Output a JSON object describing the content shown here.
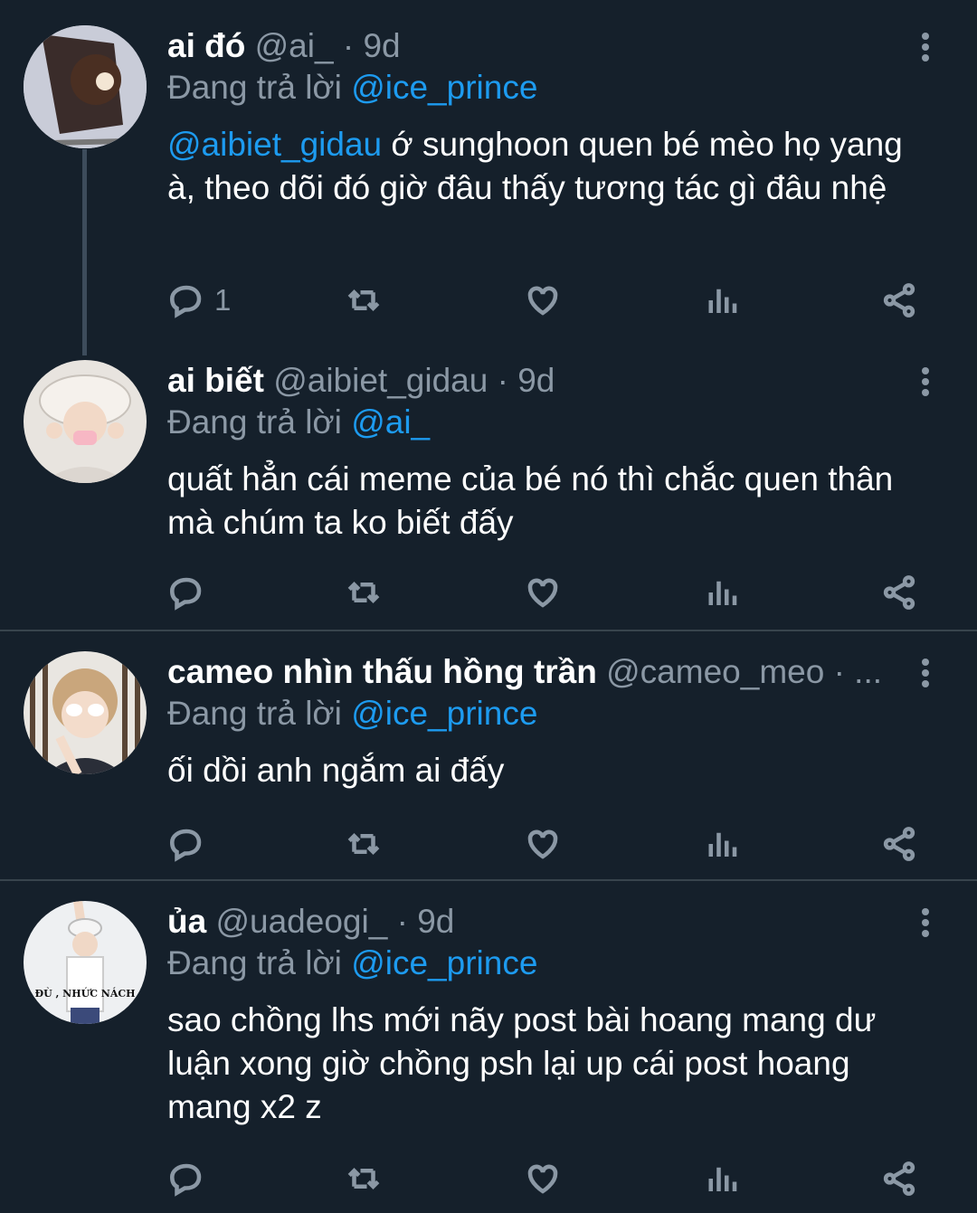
{
  "replying_label": "Đang trả lời",
  "tweets": [
    {
      "name": "ai đó",
      "handle": "@ai_",
      "dot": " · ",
      "time": "9d",
      "reply_to": "@ice_prince",
      "body_mention": "@aibiet_gidau",
      "body_text": " ớ sunghoon quen bé mèo họ yang à, theo dõi đó giờ đâu thấy tương tác gì đâu nhệ",
      "reply_count": "1"
    },
    {
      "name": "ai biết",
      "handle": "@aibiet_gidau",
      "dot": " · ",
      "time": "9d",
      "reply_to": "@ai_",
      "body_mention": "",
      "body_text": "quất hẳn cái meme của bé nó thì chắc quen thân mà chúm ta ko biết đấy",
      "reply_count": ""
    },
    {
      "name": "cameo nhìn thấu hồng trần",
      "handle": "@cameo_meo",
      "dot": " · ...",
      "time": "",
      "reply_to": "@ice_prince",
      "body_mention": "",
      "body_text": "ối dồi anh ngắm ai đấy",
      "reply_count": ""
    },
    {
      "name": "ủa",
      "handle": "@uadeogi_",
      "dot": " · ",
      "time": "9d",
      "reply_to": "@ice_prince",
      "body_mention": "",
      "body_text": "sao chồng lhs mới nãy post bài hoang mang dư luận xong giờ chồng psh lại up cái post hoang mang x2 z",
      "reply_count": "",
      "avatar_caption": "ĐÙ , NHỨC NÁCH"
    }
  ],
  "icons": [
    "reply-icon",
    "retweet-icon",
    "like-icon",
    "views-icon",
    "share-icon",
    "more-icon"
  ],
  "colors": {
    "background": "#15202b",
    "accent": "#1d9bf0",
    "muted": "#8b98a5",
    "divider": "#38444d"
  }
}
